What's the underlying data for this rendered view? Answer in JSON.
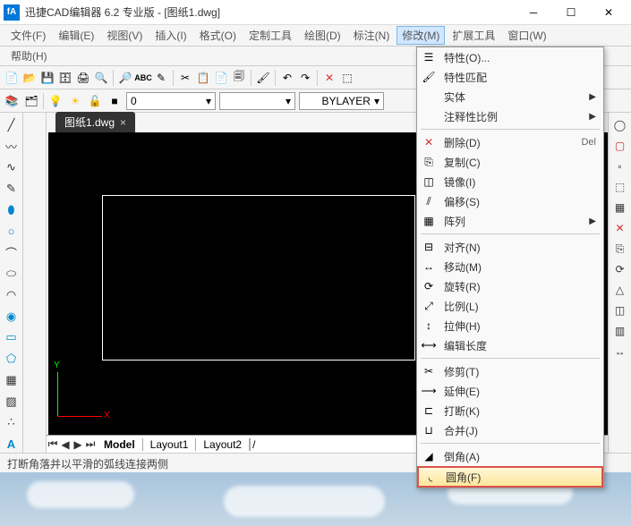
{
  "titlebar": {
    "title": "迅捷CAD编辑器 6.2 专业版  - [图纸1.dwg]"
  },
  "menus": {
    "file": "文件(F)",
    "edit": "编辑(E)",
    "view": "视图(V)",
    "insert": "插入(I)",
    "format": "格式(O)",
    "custom": "定制工具",
    "draw": "绘图(D)",
    "dim": "标注(N)",
    "modify": "修改(M)",
    "ext": "扩展工具",
    "window": "窗口(W)",
    "help": "帮助(H)"
  },
  "layerbox": {
    "value": "0",
    "bylayer": "BYLAYER"
  },
  "doc_tab": {
    "label": "图纸1.dwg"
  },
  "layouts": {
    "model": "Model",
    "l1": "Layout1",
    "l2": "Layout2"
  },
  "status": "打断角落并以平滑的弧线连接两侧",
  "dropdown": {
    "props": "特性(O)...",
    "match": "特性匹配",
    "entity": "实体",
    "annot": "注释性比例",
    "delete": "删除(D)",
    "delete_key": "Del",
    "copy": "复制(C)",
    "mirror": "镜像(I)",
    "offset": "偏移(S)",
    "array": "阵列",
    "align": "对齐(N)",
    "move": "移动(M)",
    "rotate": "旋转(R)",
    "scale": "比例(L)",
    "stretch": "拉伸(H)",
    "editlen": "编辑长度",
    "trim": "修剪(T)",
    "extend": "延伸(E)",
    "break": "打断(K)",
    "join": "合并(J)",
    "chamfer": "倒角(A)",
    "fillet": "圆角(F)"
  }
}
